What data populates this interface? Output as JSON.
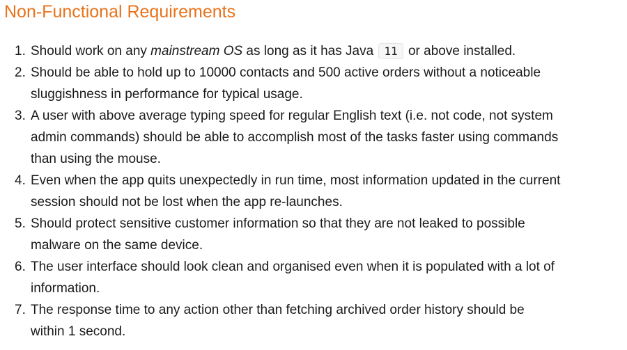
{
  "heading": "Non-Functional Requirements",
  "requirements": [
    {
      "number": "1.",
      "line1_before": "Should work on any ",
      "line1_emphasis": "mainstream OS",
      "line1_middle": " as long as it has Java ",
      "line1_code": "11",
      "line1_after": " or above installed."
    },
    {
      "number": "2.",
      "line1": "Should be able to hold up to 10000 contacts and 500 active orders without a noticeable",
      "line2": "sluggishness in performance for typical usage."
    },
    {
      "number": "3.",
      "line1": "A user with above average typing speed for regular English text (i.e. not code, not system",
      "line2": "admin commands) should be able to accomplish most of the tasks faster using commands",
      "line3": "than using the mouse."
    },
    {
      "number": "4.",
      "line1": "Even when the app quits unexpectedly in run time, most information updated in the current",
      "line2": "session should not be lost when the app re-launches."
    },
    {
      "number": "5.",
      "line1": "Should protect sensitive customer information so that they are not leaked to possible",
      "line2": "malware on the same device."
    },
    {
      "number": "6.",
      "line1": "The user interface should look clean and organised even when it is populated with a lot of",
      "line2": "information."
    },
    {
      "number": "7.",
      "line1": "The response time to any action other than fetching archived order history should be",
      "line2": "within 1 second."
    }
  ]
}
